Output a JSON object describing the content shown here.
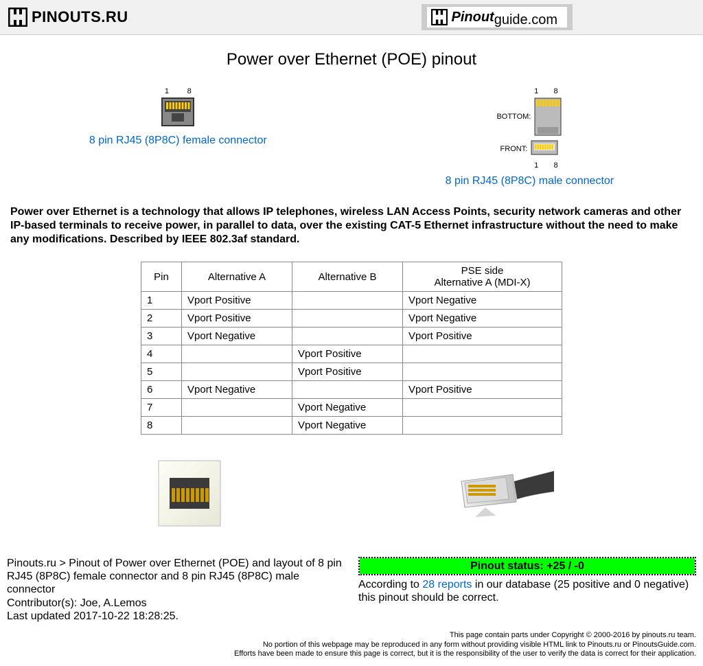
{
  "header": {
    "logo1": "PINOUTS.RU",
    "logo2a": "Pinout",
    "logo2b": "guide.com"
  },
  "title": "Power over Ethernet (POE) pinout",
  "conn": {
    "female_label": "8 pin RJ45 (8P8C) female connector",
    "male_label": "8 pin RJ45 (8P8C) male connector",
    "bottom_label": "BOTTOM:",
    "front_label": "FRONT:",
    "pin1": "1",
    "pin8": "8"
  },
  "intro": "Power over Ethernet is a technology that allows IP telephones, wireless LAN Access Points, security network cameras and other IP-based terminals to receive power, in parallel to data, over the existing CAT-5 Ethernet infrastructure without the need to make any modifications. Described by IEEE 802.3af standard.",
  "table": {
    "headers": [
      "Pin",
      "Alternative A",
      "Alternative B",
      "PSE side\nAlternative A (MDI-X)"
    ],
    "rows": [
      [
        "1",
        "Vport Positive",
        "",
        "Vport Negative"
      ],
      [
        "2",
        "Vport Positive",
        "",
        "Vport Negative"
      ],
      [
        "3",
        "Vport Negative",
        "",
        "Vport Positive"
      ],
      [
        "4",
        "",
        "Vport Positive",
        ""
      ],
      [
        "5",
        "",
        "Vport Positive",
        ""
      ],
      [
        "6",
        "Vport Negative",
        "",
        "Vport Positive"
      ],
      [
        "7",
        "",
        "Vport Negative",
        ""
      ],
      [
        "8",
        "",
        "Vport Negative",
        ""
      ]
    ]
  },
  "breadcrumb": "Pinouts.ru > Pinout of Power over Ethernet (POE) and layout of 8 pin RJ45 (8P8C) female connector and 8 pin RJ45 (8P8C) male connector",
  "contributors": "Contributor(s): Joe, A.Lemos",
  "updated": "Last updated 2017-10-22 18:28:25.",
  "status": {
    "label": "Pinout status: +25 / -0",
    "text1": "According to ",
    "reports_link": "28 reports",
    "text2": " in our database (25 positive and 0 negative) this pinout should be correct."
  },
  "copyright": {
    "l1": "This page contain parts under Copyright © 2000-2016 by pinouts.ru team.",
    "l2": "No portion of this webpage may be reproduced in any form without providing visible HTML link to Pinouts.ru or PinoutsGuide.com.",
    "l3": "Efforts have been made to ensure this page is correct, but it is the responsibility of the user to verify the data is correct for their application."
  }
}
